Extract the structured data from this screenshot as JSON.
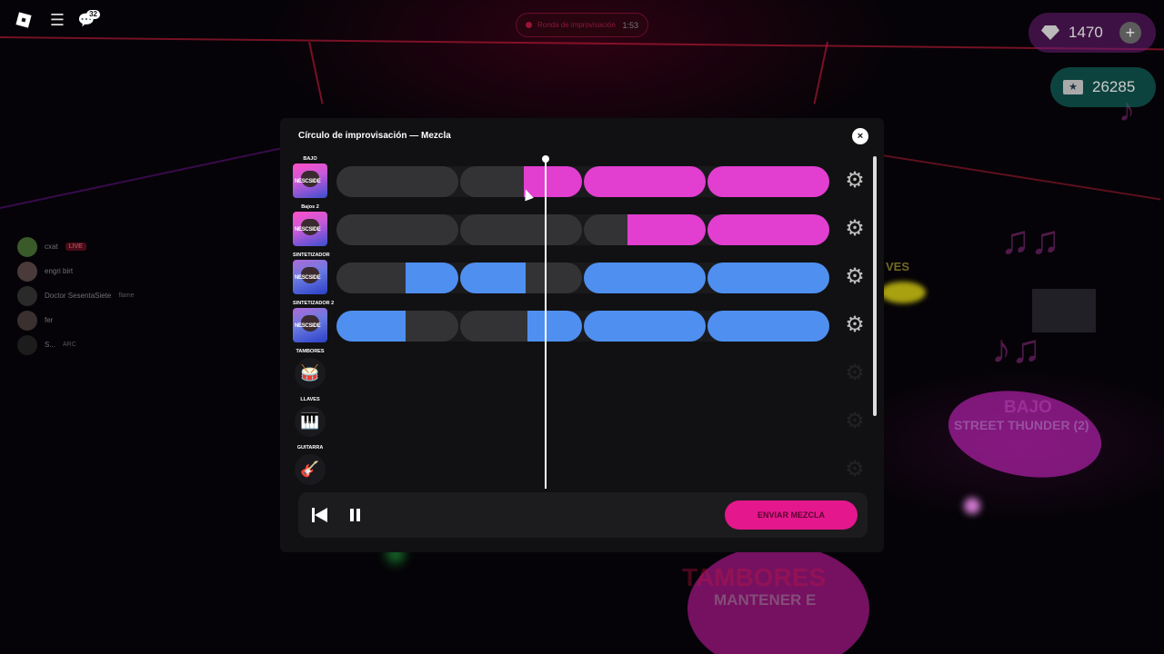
{
  "topbar": {
    "chat_badge": "32",
    "timer_label": "Ronda de improvisación",
    "timer_time": "1:53"
  },
  "currency": {
    "gems": "1470",
    "tickets": "26285"
  },
  "players": [
    {
      "name": "cxat",
      "tag": "LIVE"
    },
    {
      "name": "engri birt",
      "tag": ""
    },
    {
      "name": "Doctor SesentaSiete",
      "tag": "flame"
    },
    {
      "name": "fer",
      "tag": ""
    },
    {
      "name": "S...",
      "tag": "ARC"
    }
  ],
  "background": {
    "text_bajo": "BAJO",
    "text_song": "STREET THUNDER (2)",
    "text_tambores": "TAMBORES",
    "text_mantener": "MANTENER E",
    "text_llaves": "VES"
  },
  "dialog": {
    "title": "Círculo de improvisación — Mezcla",
    "close_symbol": "×",
    "tracks": [
      {
        "label": "BAJO",
        "color": "pink",
        "active": true
      },
      {
        "label": "Bajos 2",
        "color": "pink",
        "active": true
      },
      {
        "label": "SINTETIZADOR",
        "color": "blue",
        "active": true
      },
      {
        "label": "SINTETIZADOR 2",
        "color": "blue",
        "active": true
      },
      {
        "label": "TAMBORES",
        "color": "none",
        "active": false
      },
      {
        "label": "LLAVES",
        "color": "none",
        "active": false
      },
      {
        "label": "GUITARRA",
        "color": "none",
        "active": false
      }
    ],
    "album_text": "NESCSIDE",
    "send_button": "ENVIAR MEZCLA"
  },
  "colors": {
    "pink_segment": "#e23ed0",
    "blue_segment": "#4f8ff0",
    "send_button": "#e5178d"
  },
  "icons": {
    "gear": "⚙",
    "drum": "🥁",
    "keys": "🎹",
    "guitar": "🎸"
  }
}
